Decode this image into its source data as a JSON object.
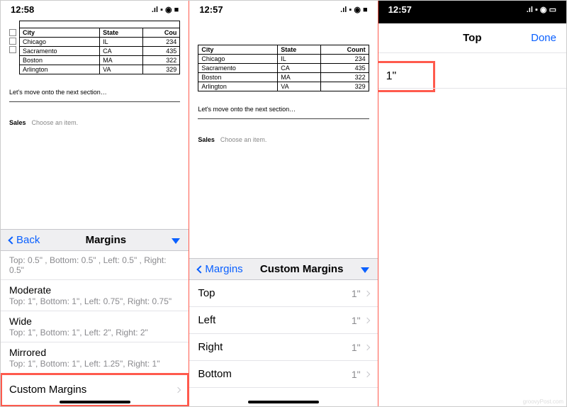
{
  "status": {
    "time1": "12:58",
    "time2": "12:57",
    "time3": "12:57",
    "signal": "▪▎▎",
    "wifi": "􀙇",
    "battery": "􀛨"
  },
  "doc": {
    "headers": [
      "City",
      "State",
      "Count"
    ],
    "rows": [
      [
        "Chicago",
        "IL",
        "234"
      ],
      [
        "Sacramento",
        "CA",
        "435"
      ],
      [
        "Boston",
        "MA",
        "322"
      ],
      [
        "Arlington",
        "VA",
        "329"
      ]
    ],
    "body_text": "Let's move onto the next section…",
    "sales_label": "Sales",
    "sales_choose": "Choose an item."
  },
  "pane1": {
    "back": "Back",
    "title": "Margins",
    "cut_desc": "Top: 0.5\" , Bottom: 0.5\" , Left: 0.5\" , Right: 0.5\"",
    "options": [
      {
        "name": "Moderate",
        "desc": "Top: 1\", Bottom: 1\", Left: 0.75\", Right: 0.75\""
      },
      {
        "name": "Wide",
        "desc": "Top: 1\", Bottom: 1\", Left: 2\", Right: 2\""
      },
      {
        "name": "Mirrored",
        "desc": "Top: 1\", Bottom: 1\", Left: 1.25\", Right: 1\""
      }
    ],
    "custom": "Custom Margins"
  },
  "pane2": {
    "back": "Margins",
    "title": "Custom Margins",
    "rows": [
      {
        "label": "Top",
        "value": "1\""
      },
      {
        "label": "Left",
        "value": "1\""
      },
      {
        "label": "Right",
        "value": "1\""
      },
      {
        "label": "Bottom",
        "value": "1\""
      }
    ]
  },
  "pane3": {
    "title": "Top",
    "done": "Done",
    "value": "1\""
  }
}
